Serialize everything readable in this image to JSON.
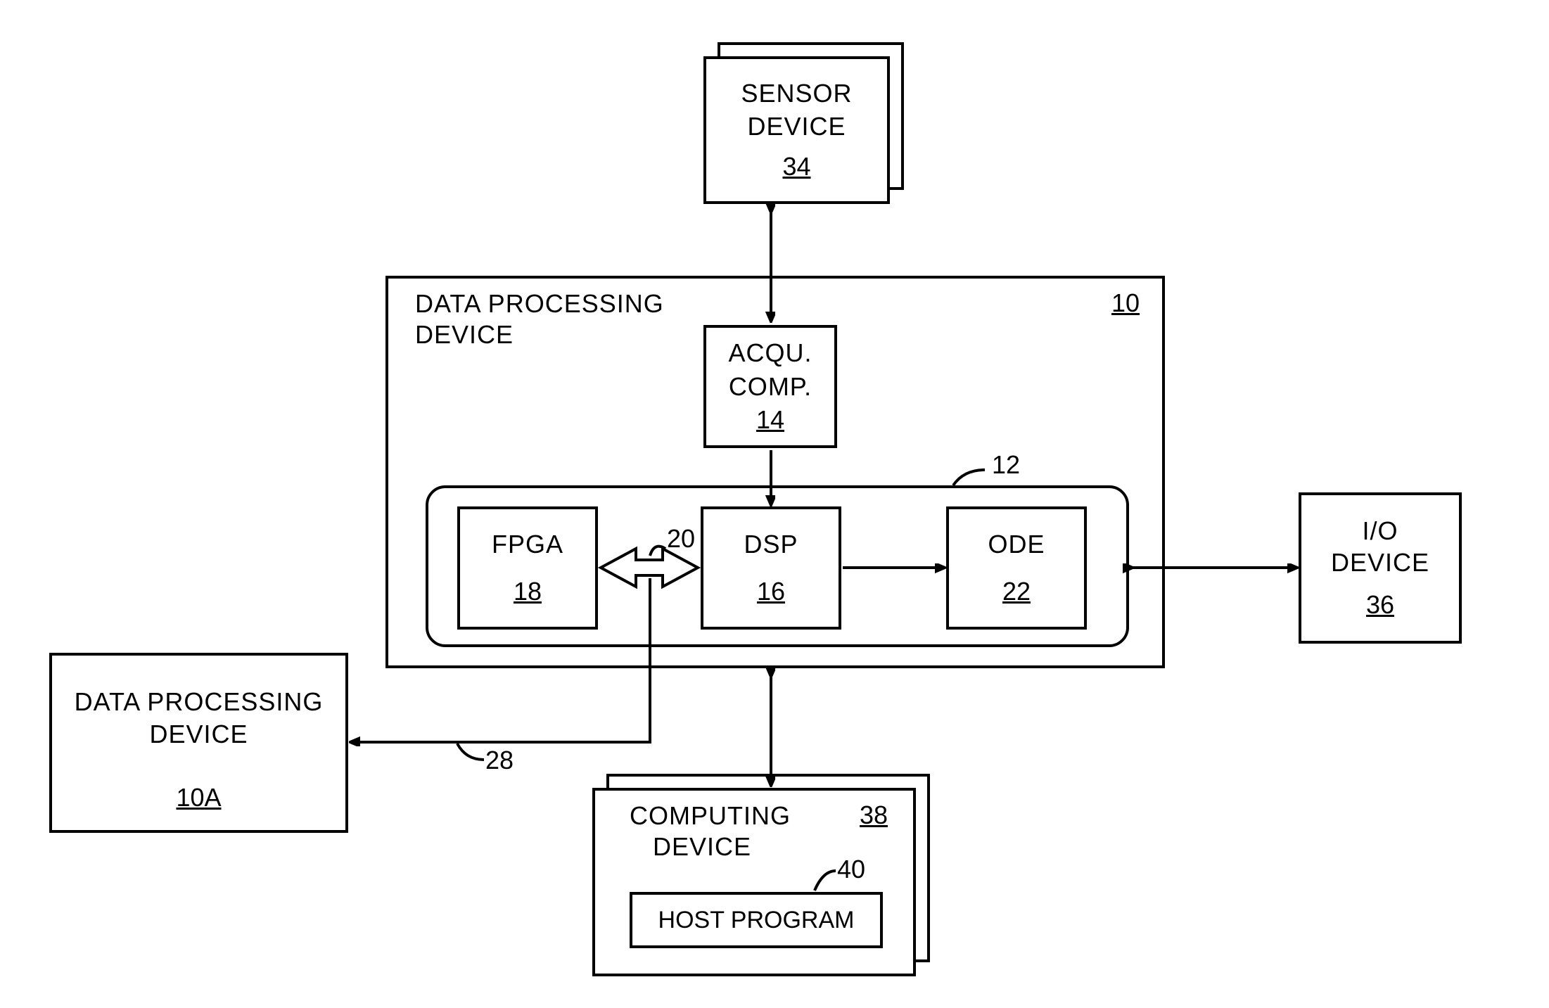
{
  "sensor": {
    "title1": "SENSOR",
    "title2": "DEVICE",
    "id": "34"
  },
  "dpd": {
    "title1": "DATA PROCESSING",
    "title2": "DEVICE",
    "id": "10"
  },
  "acqu": {
    "title1": "ACQU.",
    "title2": "COMP.",
    "id": "14"
  },
  "inner_id": "12",
  "fpga": {
    "title": "FPGA",
    "id": "18"
  },
  "dsp": {
    "title": "DSP",
    "id": "16"
  },
  "ode": {
    "title": "ODE",
    "id": "22"
  },
  "io": {
    "title1": "I/O",
    "title2": "DEVICE",
    "id": "36"
  },
  "dpd2": {
    "title1": "DATA PROCESSING",
    "title2": "DEVICE",
    "id": "10A"
  },
  "comp": {
    "title1": "COMPUTING",
    "title2": "DEVICE",
    "id": "38"
  },
  "host": {
    "title": "HOST PROGRAM",
    "id": "40"
  },
  "leader20": "20",
  "leader28": "28"
}
